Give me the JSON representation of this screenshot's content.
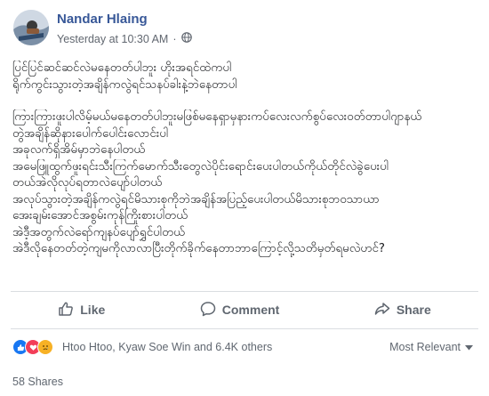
{
  "post": {
    "author": "Nandar Hlaing",
    "timestamp": "Yesterday at 10:30 AM",
    "privacy_icon": "globe-icon",
    "text_lines": [
      "ပြင်ပြင်ဆင်ဆင်လဲမနေတတ်ပါဘူး ဟိုးအရင်ထဲကပါ",
      "ရိုက်ကွင်းသွားတဲ့အချိန်ကလွဲရင်သနပ်ခါးနဲ့ဘဲနေတာပါ",
      "",
      "ကြားကြားဖူးပါလိမ့်မယ်မနေတတ်ပါဘူးမဖြစ်မနေရှာမှနားကပ်လေးလက်စွပ်လေးဝတ်တာပါဂျာနယ်",
      "တွဲအချိန်ဆိုနားပေါက်ပေါင်းလောင်းပါ",
      "အခုလက်ရှိအိမ်မှာဘဲနေပါတယ်",
      "အမေဖြူထွက်ဖူးရင်းသီးကြက်မောက်သီးတွေလဲပိုင်းရောင်းပေးပါတယ်ကိုယ်တိုင်လဲခွဲပေးပါ",
      "တယ်အဲလိုလုပ်ရတာလဲပျော်ပါတယ်",
      "အလုပ်သွားတဲ့အချိန်ကလွဲရင်မိသားစုကိုဘဲအချိန်အပြည့်ပေးပါတယ်မိသားစုဘဝသာယာ",
      "အေးချမ်းအောင်အစွမ်းကုန်ကြိုးစားပါတယ်",
      "အဲဒီ့အတွက်လဲရော်ကျနပ်ပျော်ရွှင်ပါတယ်",
      "အဲဒီလိုနေတတ်တဲ့ကျမကိုလာလာပြီးတိုက်ခိုက်နေတာဘာကြောင့်လို့သတိမှတ်ရမလဲဟင်?"
    ]
  },
  "actions": {
    "like": "Like",
    "comment": "Comment",
    "share": "Share"
  },
  "reactions": {
    "types": [
      "like",
      "love",
      "sad"
    ],
    "summary": "Htoo Htoo, Kyaw Soe Win and 6.4K others"
  },
  "sort": {
    "label": "Most Relevant"
  },
  "shares": {
    "label": "58 Shares"
  },
  "colors": {
    "author": "#385898",
    "like_blue": "#1877f2",
    "love_red": "#f33e58",
    "sad_yellow": "#f7b125",
    "muted_text": "#606770"
  }
}
